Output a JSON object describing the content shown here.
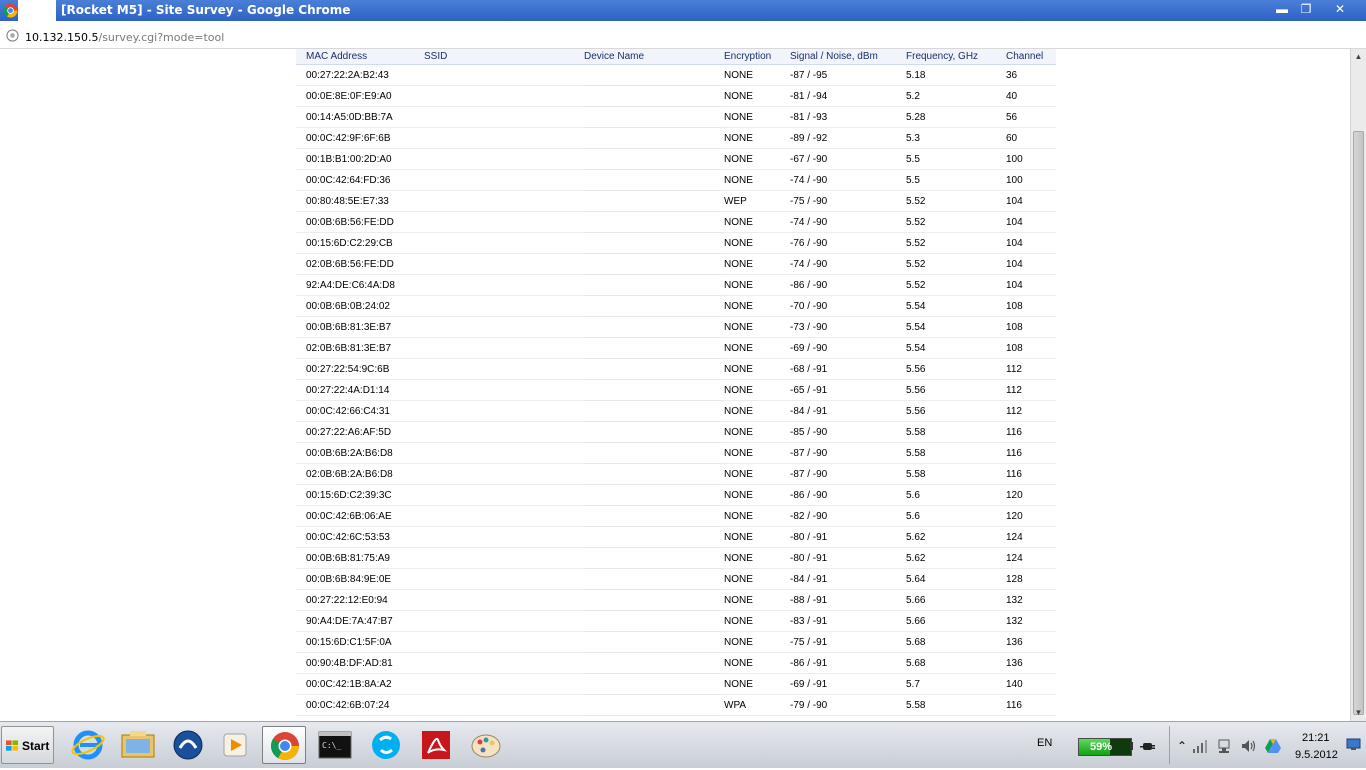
{
  "window": {
    "title": "[Rocket M5] - Site Survey - Google Chrome",
    "minimize": "▬",
    "restore": "❐",
    "close": "✕"
  },
  "address": {
    "host": "10.132.150.5",
    "path": "/survey.cgi?mode=tool"
  },
  "table": {
    "headers": [
      "MAC Address",
      "SSID",
      "Device Name",
      "Encryption",
      "Signal / Noise, dBm",
      "Frequency, GHz",
      "Channel"
    ],
    "rows": [
      [
        "00:27:22:2A:B2:43",
        "",
        "",
        "NONE",
        "-87 / -95",
        "5.18",
        "36"
      ],
      [
        "00:0E:8E:0F:E9:A0",
        "",
        "",
        "NONE",
        "-81 / -94",
        "5.2",
        "40"
      ],
      [
        "00:14:A5:0D:BB:7A",
        "",
        "",
        "NONE",
        "-81 / -93",
        "5.28",
        "56"
      ],
      [
        "00:0C:42:9F:6F:6B",
        "",
        "",
        "NONE",
        "-89 / -92",
        "5.3",
        "60"
      ],
      [
        "00:1B:B1:00:2D:A0",
        "",
        "",
        "NONE",
        "-67 / -90",
        "5.5",
        "100"
      ],
      [
        "00:0C:42:64:FD:36",
        "",
        "",
        "NONE",
        "-74 / -90",
        "5.5",
        "100"
      ],
      [
        "00:80:48:5E:E7:33",
        "",
        "",
        "WEP",
        "-75 / -90",
        "5.52",
        "104"
      ],
      [
        "00:0B:6B:56:FE:DD",
        "",
        "",
        "NONE",
        "-74 / -90",
        "5.52",
        "104"
      ],
      [
        "00:15:6D:C2:29:CB",
        "",
        "",
        "NONE",
        "-76 / -90",
        "5.52",
        "104"
      ],
      [
        "02:0B:6B:56:FE:DD",
        "",
        "",
        "NONE",
        "-74 / -90",
        "5.52",
        "104"
      ],
      [
        "92:A4:DE:C6:4A:D8",
        "",
        "",
        "NONE",
        "-86 / -90",
        "5.52",
        "104"
      ],
      [
        "00:0B:6B:0B:24:02",
        "",
        "",
        "NONE",
        "-70 / -90",
        "5.54",
        "108"
      ],
      [
        "00:0B:6B:81:3E:B7",
        "",
        "",
        "NONE",
        "-73 / -90",
        "5.54",
        "108"
      ],
      [
        "02:0B:6B:81:3E:B7",
        "",
        "",
        "NONE",
        "-69 / -90",
        "5.54",
        "108"
      ],
      [
        "00:27:22:54:9C:6B",
        "",
        "",
        "NONE",
        "-68 / -91",
        "5.56",
        "112"
      ],
      [
        "00:27:22:4A:D1:14",
        "",
        "",
        "NONE",
        "-65 / -91",
        "5.56",
        "112"
      ],
      [
        "00:0C:42:66:C4:31",
        "",
        "",
        "NONE",
        "-84 / -91",
        "5.56",
        "112"
      ],
      [
        "00:27:22:A6:AF:5D",
        "",
        "",
        "NONE",
        "-85 / -90",
        "5.58",
        "116"
      ],
      [
        "00:0B:6B:2A:B6:D8",
        "",
        "",
        "NONE",
        "-87 / -90",
        "5.58",
        "116"
      ],
      [
        "02:0B:6B:2A:B6:D8",
        "",
        "",
        "NONE",
        "-87 / -90",
        "5.58",
        "116"
      ],
      [
        "00:15:6D:C2:39:3C",
        "",
        "",
        "NONE",
        "-86 / -90",
        "5.6",
        "120"
      ],
      [
        "00:0C:42:6B:06:AE",
        "",
        "",
        "NONE",
        "-82 / -90",
        "5.6",
        "120"
      ],
      [
        "00:0C:42:6C:53:53",
        "",
        "",
        "NONE",
        "-80 / -91",
        "5.62",
        "124"
      ],
      [
        "00:0B:6B:81:75:A9",
        "",
        "",
        "NONE",
        "-80 / -91",
        "5.62",
        "124"
      ],
      [
        "00:0B:6B:84:9E:0E",
        "",
        "",
        "NONE",
        "-84 / -91",
        "5.64",
        "128"
      ],
      [
        "00:27:22:12:E0:94",
        "",
        "",
        "NONE",
        "-88 / -91",
        "5.66",
        "132"
      ],
      [
        "90:A4:DE:7A:47:B7",
        "",
        "",
        "NONE",
        "-83 / -91",
        "5.66",
        "132"
      ],
      [
        "00:15:6D:C1:5F:0A",
        "",
        "",
        "NONE",
        "-75 / -91",
        "5.68",
        "136"
      ],
      [
        "00:90:4B:DF:AD:81",
        "",
        "",
        "NONE",
        "-86 / -91",
        "5.68",
        "136"
      ],
      [
        "00:0C:42:1B:8A:A2",
        "",
        "",
        "NONE",
        "-69 / -91",
        "5.7",
        "140"
      ],
      [
        "00:0C:42:6B:07:24",
        "",
        "",
        "WPA",
        "-79 / -90",
        "5.58",
        "116"
      ]
    ]
  },
  "scrollbar": {
    "up": "▲",
    "down": "▼"
  },
  "taskbar": {
    "start_label": "Start",
    "icons": [
      "internet-explorer-icon",
      "file-explorer-icon",
      "phone-app-icon",
      "media-player-icon",
      "chrome-icon",
      "command-prompt-icon",
      "skype-icon",
      "acrobat-reader-icon",
      "paint-icon"
    ],
    "active_icon": "chrome-icon",
    "cmd_text": "C:\\_",
    "language": "EN",
    "battery_percent": "59%",
    "battery_level": 0.59,
    "tray_expand": "⌃",
    "time": "21:21",
    "date": "9.5.2012"
  },
  "colors": {
    "titlebar": "#2d62c4",
    "header_text": "#1b2f6b",
    "battery_green": "#15a015"
  }
}
